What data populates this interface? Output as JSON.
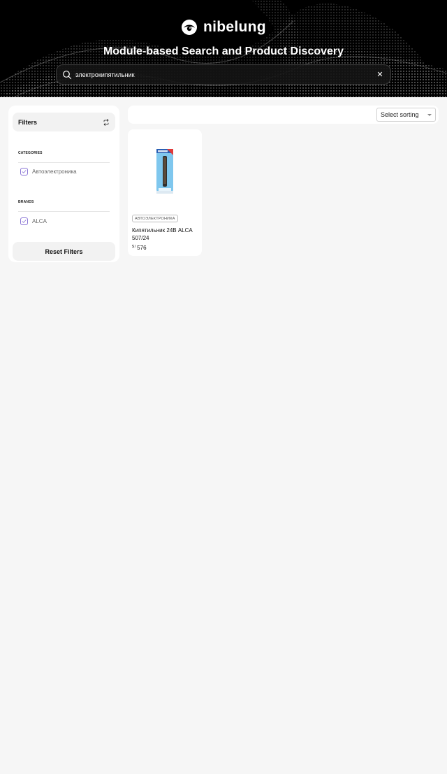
{
  "header": {
    "logo_text": "nibelung",
    "title": "Module-based Search and Product Discovery"
  },
  "search": {
    "value": "электрокипятильник",
    "clear_label": "✕"
  },
  "sidebar": {
    "title": "Filters",
    "categories_label": "CATEGORIES",
    "categories": [
      {
        "label": "Автоэлектроника",
        "checked": true
      }
    ],
    "brands_label": "BRANDS",
    "brands": [
      {
        "label": "ALCA",
        "checked": true
      }
    ],
    "reset_label": "Reset Filters"
  },
  "toolbar": {
    "sort_label": "Select sorting"
  },
  "products": [
    {
      "category": "АВТОЭЛЕКТРОНИКА",
      "name": "Кипятильник 24В ALCA 507/24",
      "currency": "$",
      "separator": "/",
      "price": "576"
    }
  ],
  "colors": {
    "accent": "#8b76d6",
    "page_bg": "#f6f6f6",
    "hero_bg": "#000000"
  }
}
